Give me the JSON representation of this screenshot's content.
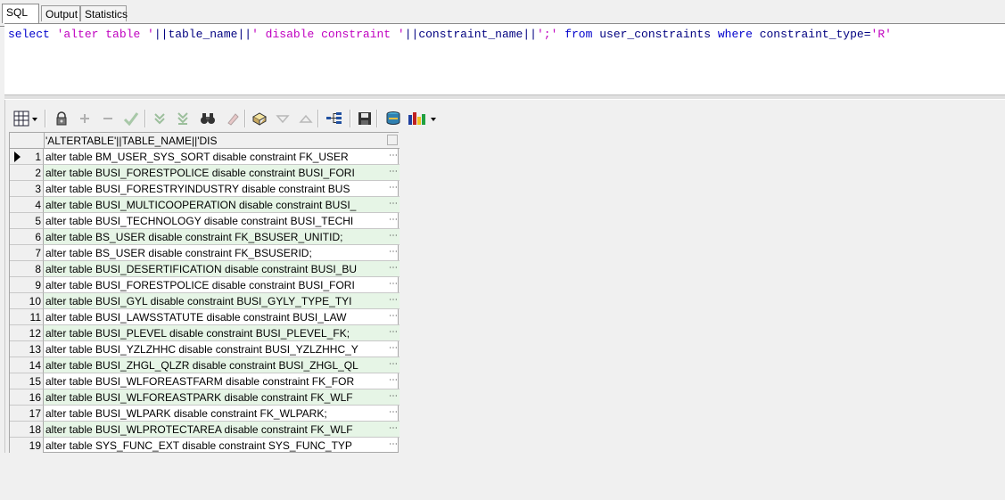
{
  "tabs": [
    "SQL",
    "Output",
    "Statistics"
  ],
  "sql": {
    "parts": [
      {
        "t": "select",
        "c": "kw"
      },
      {
        "t": " ",
        "c": ""
      },
      {
        "t": "'alter table '",
        "c": "str"
      },
      {
        "t": "||",
        "c": "id"
      },
      {
        "t": "table_name",
        "c": "id"
      },
      {
        "t": "||",
        "c": "id"
      },
      {
        "t": "' disable constraint '",
        "c": "str"
      },
      {
        "t": "||",
        "c": "id"
      },
      {
        "t": "constraint_name",
        "c": "id"
      },
      {
        "t": "||",
        "c": "id"
      },
      {
        "t": "';'",
        "c": "str"
      },
      {
        "t": " ",
        "c": ""
      },
      {
        "t": "from",
        "c": "kw"
      },
      {
        "t": " ",
        "c": ""
      },
      {
        "t": "user_constraints",
        "c": "id"
      },
      {
        "t": " ",
        "c": ""
      },
      {
        "t": "where",
        "c": "kw"
      },
      {
        "t": " ",
        "c": ""
      },
      {
        "t": "constraint_type",
        "c": "id"
      },
      {
        "t": "=",
        "c": "id"
      },
      {
        "t": "'R'",
        "c": "str"
      }
    ]
  },
  "toolbar": {
    "icons": [
      "grid-icon",
      "lock-icon",
      "plus-icon",
      "minus-icon",
      "check-icon",
      "fetch-next-icon",
      "fetch-last-icon",
      "find-icon",
      "clear-icon",
      "query-by-example-icon",
      "filter-icon",
      "sort-icon",
      "tree-icon",
      "save-icon",
      "export-icon",
      "chart-icon"
    ]
  },
  "grid": {
    "column_header": "'ALTERTABLE'||TABLE_NAME||'DIS",
    "current_row": 1,
    "rows": [
      "alter table BM_USER_SYS_SORT disable constraint FK_USER",
      "alter table BUSI_FORESTPOLICE disable constraint BUSI_FORI",
      "alter table BUSI_FORESTRYINDUSTRY disable constraint BUS",
      "alter table BUSI_MULTICOOPERATION disable constraint BUSI_",
      "alter table BUSI_TECHNOLOGY disable constraint BUSI_TECHI",
      "alter table BS_USER disable constraint FK_BSUSER_UNITID;",
      "alter table BS_USER disable constraint FK_BSUSERID;",
      "alter table BUSI_DESERTIFICATION disable constraint BUSI_BU",
      "alter table BUSI_FORESTPOLICE disable constraint BUSI_FORI",
      "alter table BUSI_GYL disable constraint BUSI_GYLY_TYPE_TYI",
      "alter table BUSI_LAWSSTATUTE disable constraint BUSI_LAW",
      "alter table BUSI_PLEVEL disable constraint BUSI_PLEVEL_FK;",
      "alter table BUSI_YZLZHHC disable constraint BUSI_YZLZHHC_Y",
      "alter table BUSI_ZHGL_QLZR disable constraint BUSI_ZHGL_QL",
      "alter table BUSI_WLFOREASTFARM disable constraint FK_FOR",
      "alter table BUSI_WLFOREASTPARK disable constraint FK_WLF",
      "alter table BUSI_WLPARK disable constraint FK_WLPARK;",
      "alter table BUSI_WLPROTECTAREA disable constraint FK_WLF",
      "alter table SYS_FUNC_EXT disable constraint SYS_FUNC_TYP"
    ],
    "more_glyph": "⋯"
  }
}
